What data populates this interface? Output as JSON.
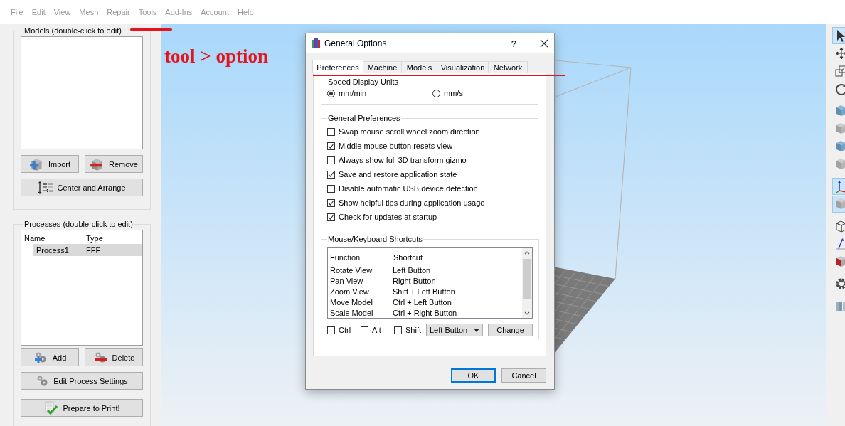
{
  "menu": [
    "File",
    "Edit",
    "View",
    "Mesh",
    "Repair",
    "Tools",
    "Add-Ins",
    "Account",
    "Help"
  ],
  "models_panel": {
    "title": "Models (double-click to edit)",
    "buttons": [
      {
        "kind": "import",
        "label": "Import"
      },
      {
        "kind": "remove",
        "label": "Remove"
      },
      {
        "kind": "arrange",
        "label": "Center and Arrange"
      }
    ]
  },
  "processes_panel": {
    "title": "Processes (double-click to edit)",
    "columns": [
      "Name",
      "Type"
    ],
    "rows": [
      {
        "name": "Process1",
        "type": "FFF",
        "selected": true
      }
    ],
    "buttons": [
      {
        "kind": "add",
        "label": "Add"
      },
      {
        "kind": "delete",
        "label": "Delete"
      },
      {
        "kind": "settings",
        "label": "Edit Process Settings"
      },
      {
        "kind": "prepare",
        "label": "Prepare to Print!"
      }
    ]
  },
  "annotation": {
    "text": "tool > option"
  },
  "dialog": {
    "title": "General Options",
    "help": "?",
    "tabs": [
      {
        "label": "Preferences",
        "selected": true
      },
      {
        "label": "Machine",
        "selected": false
      },
      {
        "label": "Models",
        "selected": false
      },
      {
        "label": "Visualization",
        "selected": false
      },
      {
        "label": "Network",
        "selected": false
      }
    ],
    "speed_units": {
      "title": "Speed Display Units",
      "options": [
        {
          "label": "mm/min",
          "selected": true
        },
        {
          "label": "mm/s",
          "selected": false
        }
      ]
    },
    "general_preferences": {
      "title": "General Preferences",
      "options": [
        {
          "label": "Swap mouse scroll wheel zoom direction",
          "checked": false
        },
        {
          "label": "Middle mouse button resets view",
          "checked": true
        },
        {
          "label": "Always show full 3D transform gizmo",
          "checked": false
        },
        {
          "label": "Save and restore application state",
          "checked": true
        },
        {
          "label": "Disable automatic USB device detection",
          "checked": false
        },
        {
          "label": "Show helpful tips during application usage",
          "checked": true
        },
        {
          "label": "Check for updates at startup",
          "checked": true
        }
      ]
    },
    "shortcuts": {
      "title": "Mouse/Keyboard Shortcuts",
      "columns": [
        "Function",
        "Shortcut"
      ],
      "rows": [
        {
          "function": "Rotate View",
          "shortcut": "Left Button"
        },
        {
          "function": "Pan View",
          "shortcut": "Right Button"
        },
        {
          "function": "Zoom View",
          "shortcut": "Shift + Left Button"
        },
        {
          "function": "Move Model",
          "shortcut": "Ctrl + Left Button"
        },
        {
          "function": "Scale Model",
          "shortcut": "Ctrl + Right Button"
        }
      ],
      "modifiers": [
        {
          "label": "Ctrl",
          "checked": false
        },
        {
          "label": "Alt",
          "checked": false
        },
        {
          "label": "Shift",
          "checked": false
        }
      ],
      "button_select": "Left Button",
      "change_button": "Change"
    },
    "buttons": [
      {
        "label": "OK",
        "default": true
      },
      {
        "label": "Cancel",
        "default": false
      }
    ]
  },
  "toolbar": [
    {
      "kind": "pointer",
      "selected": true
    },
    {
      "kind": "move",
      "selected": false
    },
    {
      "kind": "scale",
      "selected": false
    },
    {
      "kind": "rotate",
      "selected": false
    },
    {
      "kind": "cube-blue",
      "selected": false
    },
    {
      "kind": "cube-gray",
      "selected": false
    },
    {
      "kind": "cube-blue",
      "selected": false
    },
    {
      "kind": "cube-gray",
      "selected": false
    },
    {
      "kind": "axes",
      "selected": true
    },
    {
      "kind": "cube-gray",
      "selected": true
    },
    {
      "kind": "wireframe",
      "selected": false
    },
    {
      "kind": "arrow",
      "selected": false
    },
    {
      "kind": "section",
      "selected": false
    },
    {
      "kind": "gear",
      "selected": false
    },
    {
      "kind": "bars",
      "selected": false
    }
  ]
}
